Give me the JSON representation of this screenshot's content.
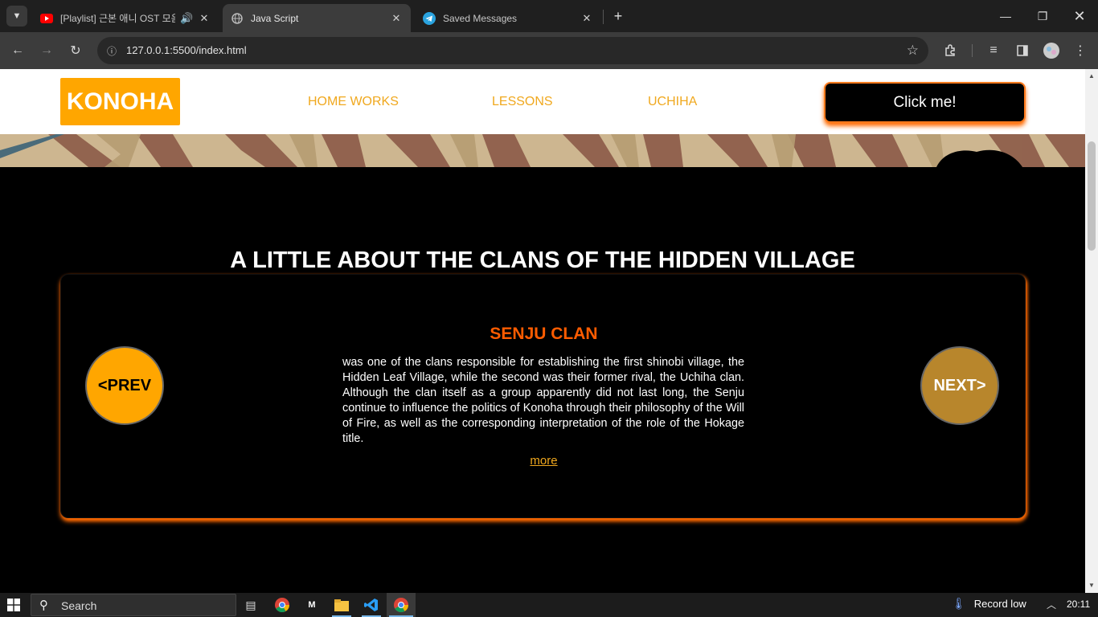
{
  "browser": {
    "tabs": [
      {
        "title": "[Playlist] 근본 애니 OST 모음",
        "active": false,
        "icon": "youtube-icon",
        "audio": true
      },
      {
        "title": "Java Script",
        "active": true,
        "icon": "globe-icon"
      },
      {
        "title": "Saved Messages",
        "active": false,
        "icon": "telegram-icon"
      }
    ],
    "url": "127.0.0.1:5500/index.html"
  },
  "header": {
    "logo": "KONOHA",
    "nav": [
      "HOME WORKS",
      "LESSONS",
      "UCHIHA"
    ],
    "cta_label": "Click me!"
  },
  "section": {
    "title": "A LITTLE ABOUT THE CLANS OF THE HIDDEN VILLAGE"
  },
  "slider": {
    "clan_title": "SENJU CLAN",
    "description": "was one of the clans responsible for establishing the first shinobi village, the Hidden Leaf Village, while the second was their former rival, the Uchiha clan. Although the clan itself as a group apparently did not last long, the Senju continue to influence the politics of Konoha through their philosophy of the Will of Fire, as well as the corresponding interpretation of the role of the Hokage title.",
    "more_label": "more",
    "prev_label": "<PREV",
    "next_label": "NEXT>"
  },
  "taskbar": {
    "search_label": "Search",
    "weather": "Record low",
    "time": "20:11"
  },
  "colors": {
    "brand_orange": "#ffa600",
    "accent_orange": "#ff5c00",
    "nav_text": "#f0a81e"
  }
}
